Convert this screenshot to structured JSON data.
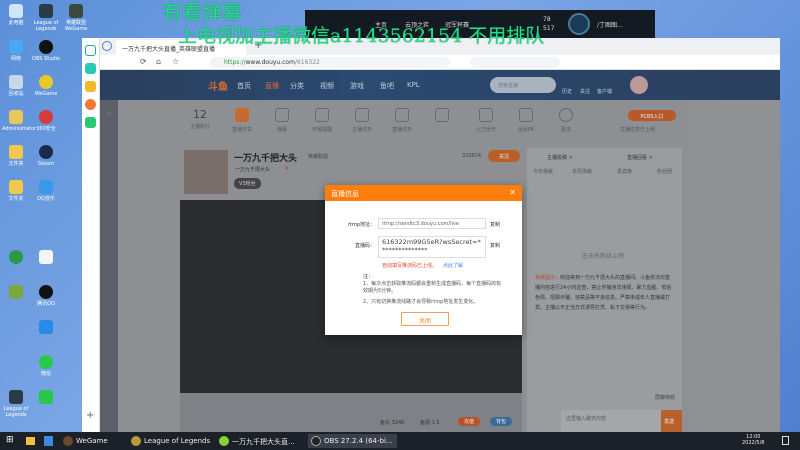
{
  "overlay": {
    "line1": "有看弹幕",
    "line2": "上电视加主播微信a1143562154 不用排队"
  },
  "game_client": {
    "tabs": [
      "主页",
      "云顶之弈",
      "冠军杯赛"
    ],
    "currency1": "78",
    "currency2": "517",
    "username": "/丁图图..."
  },
  "desktop_icons": [
    "此电脑",
    "League of Legends",
    "英雄联盟WeGame",
    "网络",
    "OBS Studio",
    "WeGame",
    "回收站",
    "Steam",
    "腾讯QQ",
    "Administrator",
    "360安全",
    "微信",
    "文件夹",
    "QQ音乐",
    "",
    ""
  ],
  "browser": {
    "tab_title": "一万九千把大头直播_英雄联盟直播",
    "url_prefix": "https://",
    "url_host": "www.douyu.com",
    "url_path": "/616322",
    "new_tab": "+"
  },
  "douyu": {
    "logo": "斗鱼",
    "nav": [
      "首页",
      "直播",
      "分类",
      "视频",
      "游戏",
      "鱼吧",
      "KPL"
    ],
    "search_placeholder": "搜索直播",
    "header_icons": [
      "历史",
      "关注",
      "客户端"
    ],
    "side": [
      "关注",
      "",
      "",
      "",
      "",
      ""
    ],
    "toolbar": {
      "level": "12",
      "level_label": "主播积分",
      "items": [
        "直播开关",
        "弹幕",
        "开播提醒",
        "主播任务",
        "直播任务",
        "",
        "火力全开",
        "全民PK",
        "更多"
      ],
      "pcbs_button": "PCBS入口",
      "pcbs_sub": "主播任务已上线"
    },
    "streamer": {
      "name": "一万九千把大头",
      "tag": "英雄联盟",
      "sub": "一万九千把大头",
      "hot": "4",
      "fans": "320824",
      "follow_button": "关注",
      "fans_badge": "V3粉丝"
    },
    "chat": {
      "tabs": [
        "今日贡献",
        "本周贡献",
        "贵宾席",
        "粉丝团"
      ],
      "top_links": [
        "主播投稿 >",
        "直播回看 >"
      ],
      "empty": "还未有粉丝上榜",
      "system_label": "系统提示：",
      "system_msg": "欢迎来到一万九千把大头的直播间。斗鱼依法对直播内容进行24小时巡查，禁止传播违法违规、暴力血腥、低俗色情、招嫖诈骗、违禁品等不良信息。严禁未成年人直播或打赏。主播以不正当方式诱导打赏、私下交易等行为。",
      "input_placeholder": "这里输入聊天内容",
      "send": "发送",
      "block": "屏蔽特效"
    },
    "gifts_bar": {
      "fish_balls": "鱼丸 3240",
      "fish_wings": "鱼翅 1.5",
      "recharge": "充值",
      "bag": "背包"
    }
  },
  "dialog": {
    "title": "直播信息",
    "rtmp_label": "rtmp地址：",
    "rtmp_value": "rtmp://sendtc3.douyu.com/live",
    "code_label": "直播码：",
    "code_value": "616322m99G5eR?wsSecret=***************",
    "copy": "复制",
    "warning": "自动填写推流码已上线。",
    "learn": "点此了解",
    "note_title": "注：",
    "note1": "1、每次点击获取推流码都会重新生成直播码，每个直播码的有效期为5分钟。",
    "note2": "2、只有切换推流线路才会导致rtmp地址发生变化。",
    "close": "关闭"
  },
  "taskbar": {
    "apps": [
      "WeGame",
      "League of Legends",
      "一万九千把大头直...",
      "OBS 27.2.4 (64-bi..."
    ],
    "time": "12:00",
    "date": "2022/5/8"
  },
  "colors": {
    "accent": "#ff7d0a",
    "overlay_text": "#21e08a",
    "nav": "#2b3f5e"
  }
}
